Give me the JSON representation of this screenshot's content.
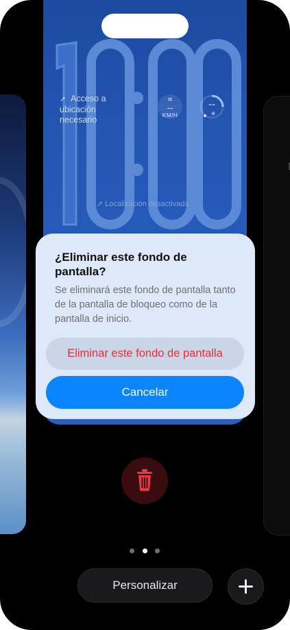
{
  "lockscreen": {
    "time": "10:00",
    "location_widget": "Acceso a ubicación necesario",
    "wind_value": "--",
    "wind_unit": "KM/H",
    "gauge_value": "--",
    "location_off": "Localización desactivada"
  },
  "dialog": {
    "title": "¿Eliminar este fondo de pantalla?",
    "message": "Se eliminará este fondo de pantalla tanto de la pantalla de bloqueo como de la pantalla de inicio.",
    "delete_label": "Eliminar este fondo de pantalla",
    "cancel_label": "Cancelar"
  },
  "bottom": {
    "customize_label": "Personalizar",
    "page_count": 3,
    "active_page": 2
  },
  "icons": {
    "delete": "trash-icon",
    "add": "plus-icon",
    "location": "location-arrow-icon",
    "wifi": "wifi-icon",
    "sun": "sun-icon"
  },
  "colors": {
    "accent": "#0a84ff",
    "destructive": "#ea2e3c",
    "lock_blue": "#2558b6",
    "dialog_bg": "#dde9f8"
  }
}
